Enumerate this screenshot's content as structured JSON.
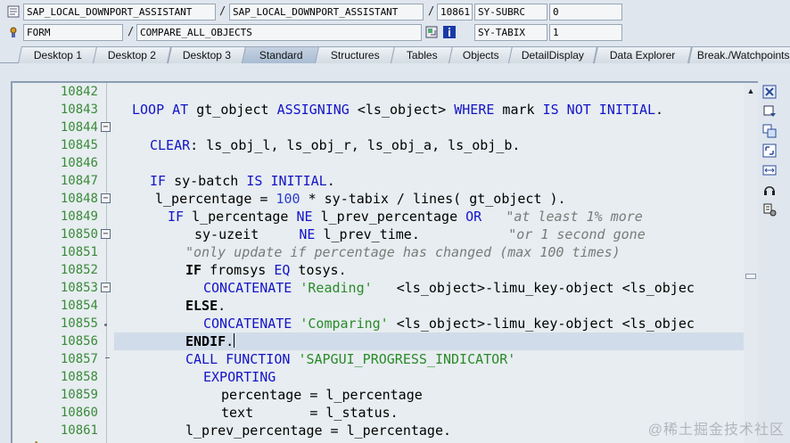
{
  "header": {
    "row1": {
      "program1": "SAP_LOCAL_DOWNPORT_ASSISTANT",
      "sep1": "/",
      "program2": "SAP_LOCAL_DOWNPORT_ASSISTANT",
      "sep2": "/",
      "line": "10861",
      "var_name": "SY-SUBRC",
      "var_value": "0"
    },
    "row2": {
      "event_type": "FORM",
      "sep": "/",
      "event_name": "COMPARE_ALL_OBJECTS",
      "var_name": "SY-TABIX",
      "var_value": "1"
    }
  },
  "tabs": [
    {
      "label": "Desktop 1"
    },
    {
      "label": "Desktop 2"
    },
    {
      "label": "Desktop 3"
    },
    {
      "label": "Standard"
    },
    {
      "label": "Structures"
    },
    {
      "label": "Tables"
    },
    {
      "label": "Objects"
    },
    {
      "label": "DetailDisplay"
    },
    {
      "label": "Data Explorer"
    },
    {
      "label": "Break./Watchpoints"
    }
  ],
  "active_tab": "Standard",
  "editor": {
    "line_numbers": [
      "10842",
      "10843",
      "10844",
      "10845",
      "10846",
      "10847",
      "10848",
      "10849",
      "10850",
      "10851",
      "10852",
      "10853",
      "10854",
      "10855",
      "10856",
      "10857",
      "10858",
      "10859",
      "10860",
      "10861"
    ],
    "current_line": "10856",
    "execution_line": "10861",
    "fold_markers": [
      "10843",
      "10847",
      "10849",
      "10852"
    ],
    "code_lines": [
      {
        "no": "10842",
        "text": ""
      },
      {
        "no": "10843",
        "text": "LOOP AT gt_object ASSIGNING <ls_object> WHERE mark IS NOT INITIAL."
      },
      {
        "no": "10844",
        "text": ""
      },
      {
        "no": "10845",
        "text": "CLEAR: ls_obj_l, ls_obj_r, ls_obj_a, ls_obj_b."
      },
      {
        "no": "10846",
        "text": ""
      },
      {
        "no": "10847",
        "text": "IF sy-batch IS INITIAL."
      },
      {
        "no": "10848",
        "text": "l_percentage = 100 * sy-tabix / lines( gt_object )."
      },
      {
        "no": "10849",
        "text": "IF l_percentage NE l_prev_percentage OR   \"at least 1% more"
      },
      {
        "no": "10850",
        "text": "sy-uzeit     NE l_prev_time.           \"or 1 second gone"
      },
      {
        "no": "10851",
        "text": "\"only update if percentage has changed (max 100 times)"
      },
      {
        "no": "10852",
        "text": "IF fromsys EQ tosys."
      },
      {
        "no": "10853",
        "text": "CONCATENATE 'Reading'   <ls_object>-limu_key-object <ls_objec"
      },
      {
        "no": "10854",
        "text": "ELSE."
      },
      {
        "no": "10855",
        "text": "CONCATENATE 'Comparing' <ls_object>-limu_key-object <ls_objec"
      },
      {
        "no": "10856",
        "text": "ENDIF."
      },
      {
        "no": "10857",
        "text": "CALL FUNCTION 'SAPGUI_PROGRESS_INDICATOR'"
      },
      {
        "no": "10858",
        "text": "EXPORTING"
      },
      {
        "no": "10859",
        "text": "percentage = l_percentage"
      },
      {
        "no": "10860",
        "text": "text       = l_status."
      },
      {
        "no": "10861",
        "text": "l_prev_percentage = l_percentage."
      }
    ]
  },
  "toolbar_icons": [
    "close-icon",
    "dropdown-icon",
    "copy-icon",
    "fullscreen-icon",
    "split-icon",
    "headset-icon",
    "settings-icon"
  ],
  "watermark": "@稀土掘金技术社区",
  "colors": {
    "keyword": "#1414c8",
    "string": "#2a8a2a",
    "comment": "#7a7a7a",
    "line_number": "#3a8a3a",
    "current_line_bg": "#d1dcea",
    "editor_bg": "#e7edf0"
  }
}
